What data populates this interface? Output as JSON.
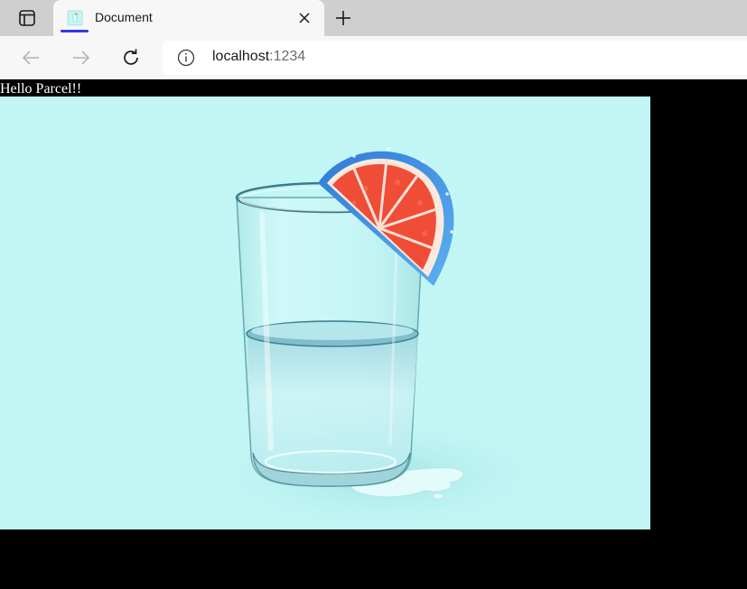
{
  "browser": {
    "tab": {
      "title": "Document",
      "favicon": "document-favicon-icon",
      "close_icon": "close-icon"
    },
    "tab_actions_icon": "tab-actions-icon",
    "new_tab_icon": "plus-icon",
    "nav": {
      "back_icon": "arrow-left-icon",
      "forward_icon": "arrow-right-icon",
      "refresh_icon": "refresh-icon"
    },
    "address": {
      "info_icon": "info-icon",
      "host": "localhost",
      "port": ":1234"
    },
    "accent_color": "#2c39e8"
  },
  "page": {
    "heading": "Hello Parcel!!",
    "image": {
      "subject": "glass-of-water-with-grapefruit-slice",
      "background_color": "#c2f6f5"
    }
  }
}
